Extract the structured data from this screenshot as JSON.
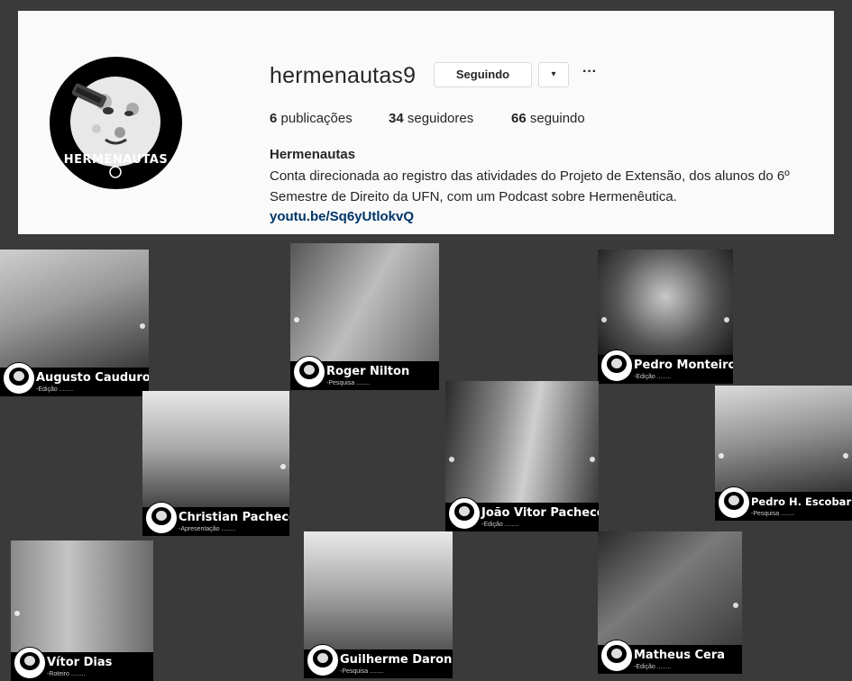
{
  "profile": {
    "logo_text": "HERMENAUTAS",
    "username": "hermenautas9",
    "follow_label": "Seguindo",
    "dropdown_icon": "▾",
    "more_icon": "···",
    "stats": {
      "posts_count": "6",
      "posts_label": "publicações",
      "followers_count": "34",
      "followers_label": "seguidores",
      "following_count": "66",
      "following_label": "seguindo"
    },
    "full_name": "Hermenautas",
    "bio": "Conta direcionada ao registro das atividades do Projeto de Extensão, dos alunos do 6º Semestre de Direito da UFN, com um Podcast sobre Hermenêutica.",
    "link": "youtu.be/Sq6yUtlokvQ"
  },
  "members": [
    {
      "name": "Augusto Cauduro",
      "role": "-Edição ........"
    },
    {
      "name": "Roger Nilton",
      "role": "-Pesquisa ........"
    },
    {
      "name": "Pedro Monteiro",
      "role": "-Edição ........"
    },
    {
      "name": "Christian Pacheco",
      "role": "-Apresentação ........"
    },
    {
      "name": "João Vitor Pacheco",
      "role": "-Edição ........"
    },
    {
      "name": "Pedro H. Escobar",
      "role": "-Pesquisa ........"
    },
    {
      "name": "Vítor Dias",
      "role": "-Roteiro ........"
    },
    {
      "name": "Guilherme Daronco",
      "role": "-Pesquisa ........"
    },
    {
      "name": "Matheus Cera",
      "role": "-Edição ........"
    }
  ]
}
